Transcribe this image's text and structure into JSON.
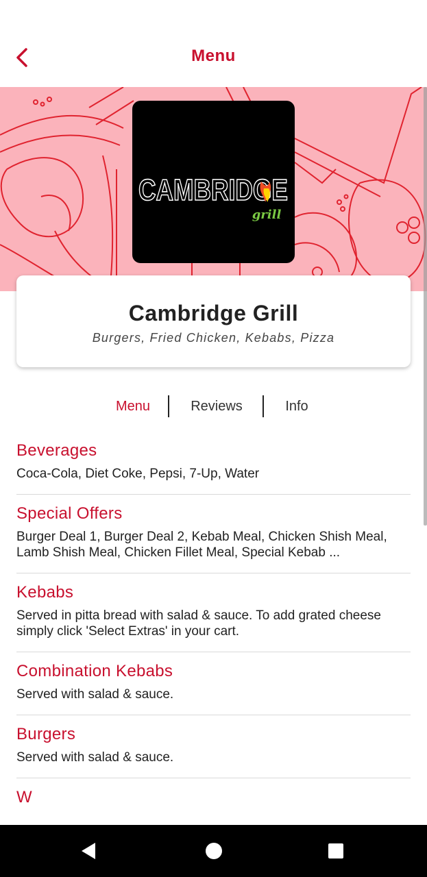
{
  "colors": {
    "accent": "#c8102e",
    "hero_bg": "#fbb3bb",
    "hero_lines": "#e0232f"
  },
  "header": {
    "title": "Menu",
    "back_icon": "chevron-left-icon"
  },
  "logo": {
    "line1": "CAMBRIDGE",
    "line2": "grill"
  },
  "restaurant": {
    "name": "Cambridge Grill",
    "cuisine": "Burgers, Fried Chicken, Kebabs, Pizza"
  },
  "tabs": [
    {
      "label": "Menu",
      "active": true
    },
    {
      "label": "Reviews",
      "active": false
    },
    {
      "label": "Info",
      "active": false
    }
  ],
  "categories": [
    {
      "title": "Beverages",
      "description": "Coca-Cola, Diet Coke, Pepsi, 7-Up, Water"
    },
    {
      "title": "Special Offers",
      "description": "Burger Deal 1, Burger Deal 2, Kebab Meal, Chicken Shish Meal, Lamb Shish Meal, Chicken Fillet Meal, Special Kebab ..."
    },
    {
      "title": "Kebabs",
      "description": "Served in pitta bread with salad & sauce. To add grated cheese simply click 'Select Extras' in your cart."
    },
    {
      "title": "Combination Kebabs",
      "description": "Served with salad & sauce."
    },
    {
      "title": "Burgers",
      "description": "Served with salad & sauce."
    },
    {
      "title": "W",
      "description": ""
    }
  ],
  "navbar": {
    "back": "nav-back-icon",
    "home": "nav-home-icon",
    "recents": "nav-recents-icon"
  }
}
